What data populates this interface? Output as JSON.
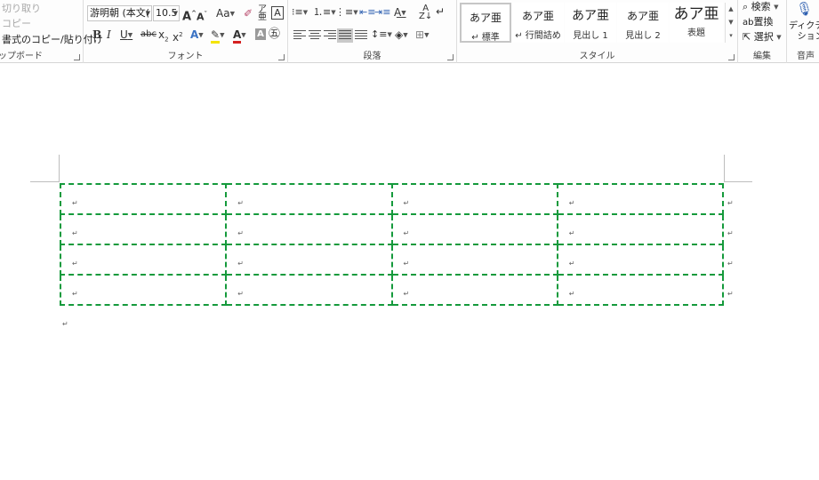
{
  "ribbon": {
    "clipboard": {
      "cut": "切り取り",
      "copy": "コピー",
      "format_painter": "書式のコピー/貼り付け",
      "label": "ップボード"
    },
    "font": {
      "font_name": "游明朝 (本文(",
      "font_size": "10.5",
      "grow": "A",
      "shrink": "A",
      "change_case": "Aa",
      "bold": "B",
      "italic": "I",
      "underline": "U",
      "strike": "abc",
      "subscript": "x",
      "superscript": "x",
      "font_color": "A",
      "label": "フォント"
    },
    "paragraph": {
      "label": "段落"
    },
    "styles": {
      "items": [
        {
          "sample": "あア亜",
          "name": "↵ 標準"
        },
        {
          "sample": "あア亜",
          "name": "↵ 行間詰め"
        },
        {
          "sample": "あア亜",
          "name": "見出し 1"
        },
        {
          "sample": "あア亜",
          "name": "見出し 2"
        },
        {
          "sample": "あア亜",
          "name": "表題"
        }
      ],
      "label": "スタイル"
    },
    "editing": {
      "find": "検索",
      "replace": "置換",
      "select": "選択",
      "label": "編集"
    },
    "voice": {
      "dictate_line1": "ディクテー",
      "dictate_line2": "ション",
      "label": "音声"
    }
  },
  "colors": {
    "table_border": "#159a3c",
    "highlight": "#f4e400",
    "font_color": "#d42020"
  },
  "document": {
    "cell_mark": "↵",
    "table": {
      "rows": [
        [
          "↵",
          "↵",
          "↵",
          "↵"
        ],
        [
          "↵",
          "↵",
          "↵",
          "↵"
        ],
        [
          "↵",
          "↵",
          "↵",
          "↵"
        ],
        [
          "↵",
          "↵",
          "↵",
          "↵"
        ]
      ]
    }
  }
}
